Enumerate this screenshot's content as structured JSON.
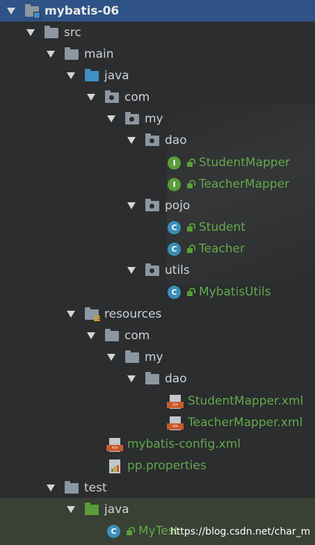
{
  "tree": {
    "project": "mybatis-06",
    "src": "src",
    "main": "main",
    "java": "java",
    "com": "com",
    "my": "my",
    "dao": "dao",
    "student_mapper": "StudentMapper",
    "teacher_mapper": "TeacherMapper",
    "pojo": "pojo",
    "student": "Student",
    "teacher": "Teacher",
    "utils": "utils",
    "mybatis_utils": "MybatisUtils",
    "resources": "resources",
    "res_com": "com",
    "res_my": "my",
    "res_dao": "dao",
    "student_mapper_xml": "StudentMapper.xml",
    "teacher_mapper_xml": "TeacherMapper.xml",
    "mybatis_config": "mybatis-config.xml",
    "pp_properties": "pp.properties",
    "test": "test",
    "test_java": "java",
    "my_test": "MyTest"
  },
  "icons": {
    "interface_letter": "I",
    "class_letter": "C",
    "xml_tag": "<>"
  },
  "watermark": "https://blog.csdn.net/char_m",
  "colors": {
    "selected_row": "#2f5287",
    "green_text": "#62a94a",
    "folder_gray": "#8d97a1",
    "source_blue": "#3f8fc7",
    "xml_orange": "#c95a2b"
  }
}
